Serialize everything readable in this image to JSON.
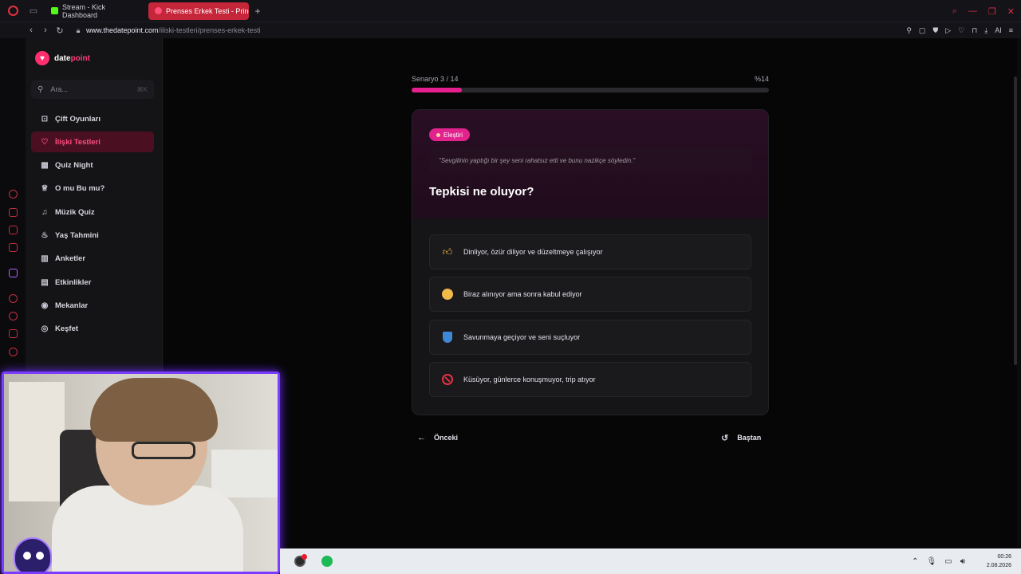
{
  "browser": {
    "tabs": [
      {
        "label": "Stream - Kick Dashboard",
        "active": false
      },
      {
        "label": "Prenses Erkek Testi - Prinç",
        "active": true
      }
    ],
    "new_tab": "+",
    "url_domain": "www.thedatepoint.com",
    "url_path": "/iliski-testleri/prenses-erkek-testi",
    "ai_label": "AI"
  },
  "site": {
    "logo_prefix": "date",
    "logo_suffix": "point",
    "search": {
      "placeholder": "Ara...",
      "shortcut": "⌘K"
    },
    "nav": [
      {
        "label": "Çift Oyunları",
        "icon": "gamepad-icon",
        "glyph": "⊡",
        "active": false
      },
      {
        "label": "İlişki Testleri",
        "icon": "heart-icon",
        "glyph": "♡",
        "active": true
      },
      {
        "label": "Quiz Night",
        "icon": "grid-icon",
        "glyph": "▦",
        "active": false
      },
      {
        "label": "O mu Bu mu?",
        "icon": "trophy-icon",
        "glyph": "♕",
        "active": false
      },
      {
        "label": "Müzik Quiz",
        "icon": "headphones-icon",
        "glyph": "♫",
        "active": false
      },
      {
        "label": "Yaş Tahmini",
        "icon": "cake-icon",
        "glyph": "♨",
        "active": false
      },
      {
        "label": "Anketler",
        "icon": "chart-icon",
        "glyph": "▥",
        "active": false
      },
      {
        "label": "Etkinlikler",
        "icon": "calendar-icon",
        "glyph": "▤",
        "active": false
      },
      {
        "label": "Mekanlar",
        "icon": "pin-icon",
        "glyph": "◉",
        "active": false
      },
      {
        "label": "Keşfet",
        "icon": "compass-icon",
        "glyph": "◎",
        "active": false
      }
    ]
  },
  "quiz": {
    "scenario": "Senaryo 3 / 14",
    "percent": "%14",
    "progress": 0.14,
    "badge": "Eleştiri",
    "quote": "\"Sevgilinin yaptığı bir şey seni rahatsız etti ve bunu nazikçe söyledin.\"",
    "question": "Tepkisi ne oluyor?",
    "options": [
      {
        "text": "Dinliyor, özür diliyor ve düzeltmeye çalışıyor",
        "icon": "thumbs-up-icon"
      },
      {
        "text": "Biraz alınıyor ama sonra kabul ediyor",
        "icon": "neutral-face-icon"
      },
      {
        "text": "Savunmaya geçiyor ve seni suçluyor",
        "icon": "shield-icon"
      },
      {
        "text": "Küsüyor, günlerce konuşmuyor, trip atıyor",
        "icon": "no-entry-icon"
      }
    ],
    "prev_label": "Önceki",
    "restart_label": "Baştan"
  },
  "taskbar": {
    "time": "00:26",
    "date": "2.08.2026"
  },
  "colors": {
    "accent": "#e61f8f",
    "brand": "#ff2e6e",
    "active_nav_bg": "#4a1022",
    "tab_active": "#c6263a",
    "webcam_border": "#7a3cff"
  }
}
